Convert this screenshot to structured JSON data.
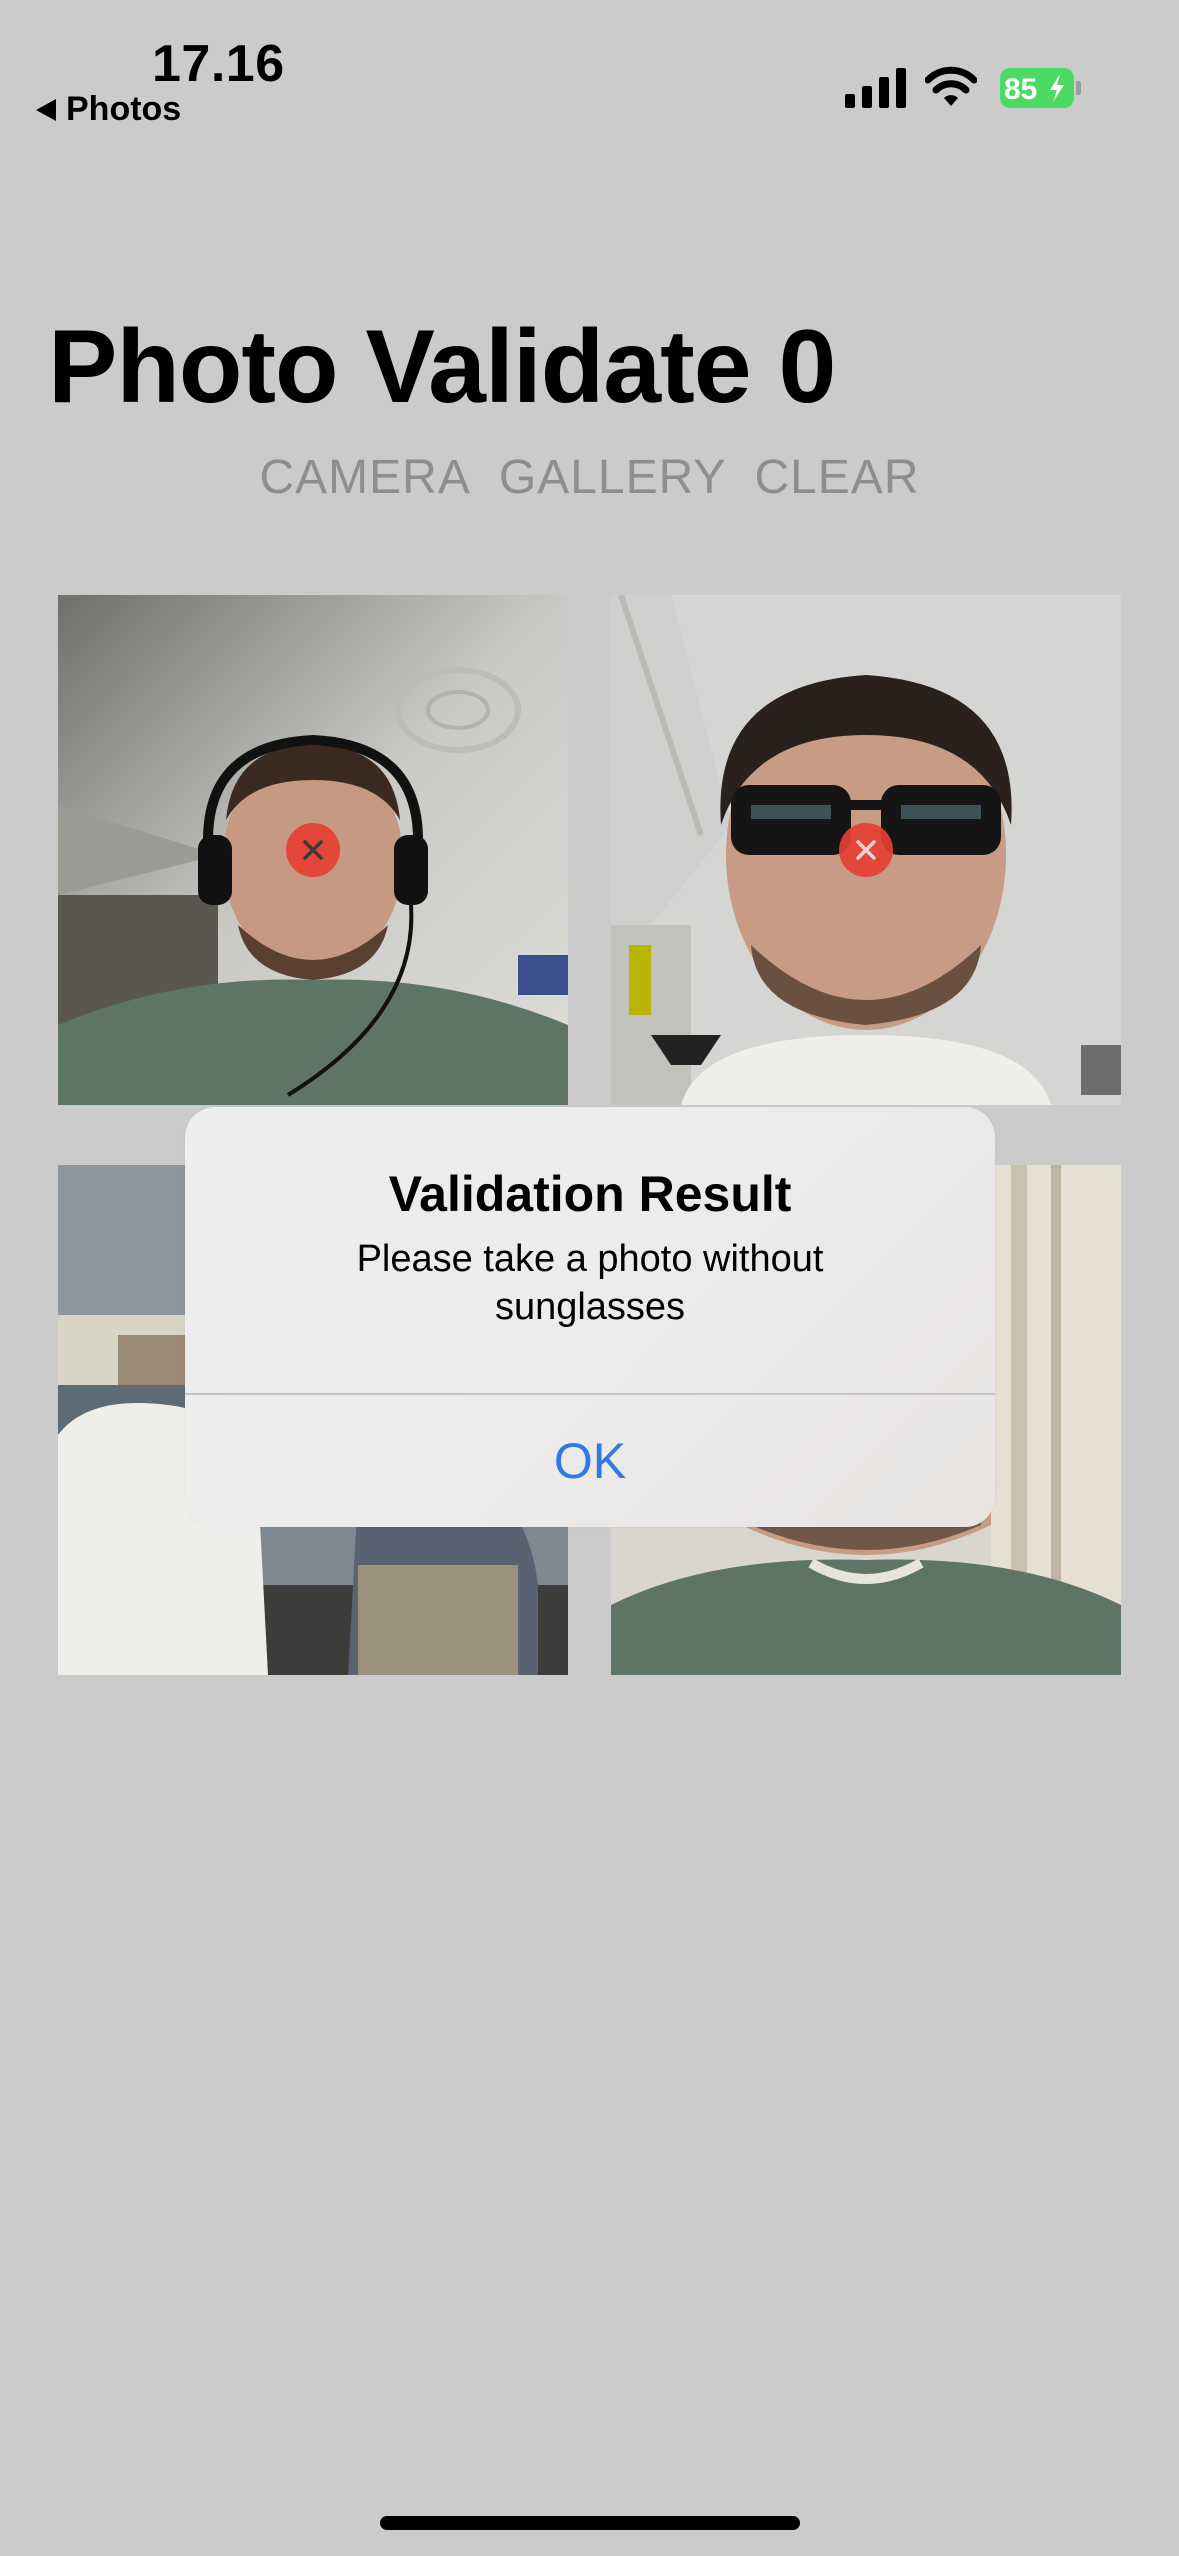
{
  "status_bar": {
    "time": "17.16",
    "back_label": "Photos",
    "battery_level": "85"
  },
  "header": {
    "title": "Photo Validate 0"
  },
  "actions": {
    "camera": "CAMERA",
    "gallery": "GALLERY",
    "clear": "CLEAR"
  },
  "colors": {
    "background": "#cbcbcb",
    "reject_badge": "#e54034",
    "alert_button": "#2f7ae5",
    "battery": "#4cd964"
  },
  "alert": {
    "title": "Validation Result",
    "message": "Please take a photo without sunglasses",
    "ok_label": "OK"
  }
}
